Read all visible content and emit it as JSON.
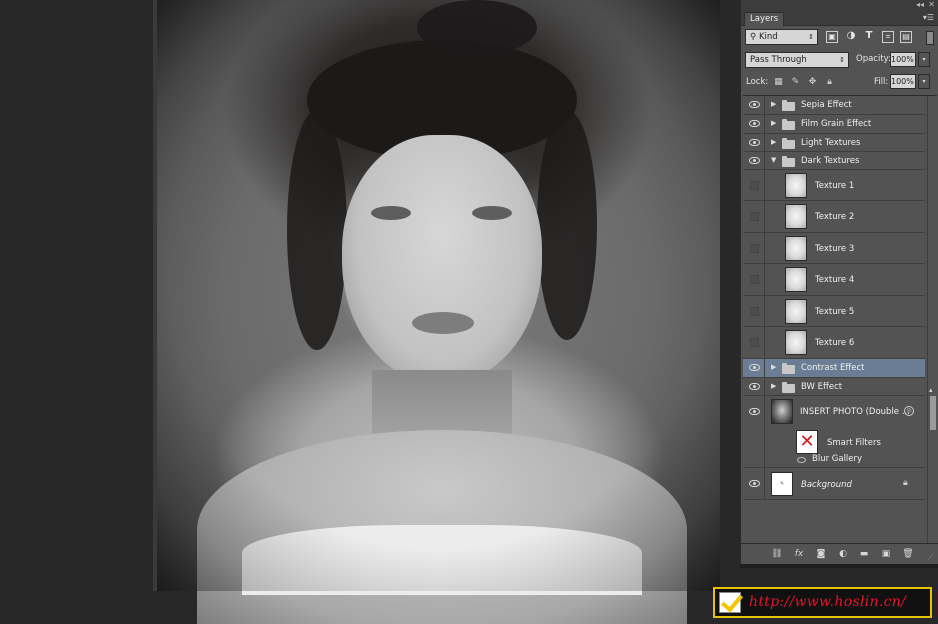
{
  "canvas": {
    "description_icon": "portrait-photo"
  },
  "panel": {
    "tab_label": "Layers",
    "kind_filter": {
      "value": "Kind"
    },
    "blend_mode": {
      "value": "Pass Through"
    },
    "opacity": {
      "label": "Opacity:",
      "value": "100%"
    },
    "lock": {
      "label": "Lock:"
    },
    "fill": {
      "label": "Fill:",
      "value": "100%"
    },
    "layers": [
      {
        "name": "Sepia Effect",
        "type": "group",
        "visible": true,
        "expanded": false
      },
      {
        "name": "Film Grain Effect",
        "type": "group",
        "visible": true,
        "expanded": false
      },
      {
        "name": "Light Textures",
        "type": "group",
        "visible": true,
        "expanded": false
      },
      {
        "name": "Dark Textures",
        "type": "group",
        "visible": true,
        "expanded": true
      },
      {
        "name": "Texture 1",
        "type": "texture",
        "visible": false
      },
      {
        "name": "Texture 2",
        "type": "texture",
        "visible": false
      },
      {
        "name": "Texture 3",
        "type": "texture",
        "visible": false
      },
      {
        "name": "Texture 4",
        "type": "texture",
        "visible": false
      },
      {
        "name": "Texture 5",
        "type": "texture",
        "visible": false
      },
      {
        "name": "Texture 6",
        "type": "texture",
        "visible": false
      },
      {
        "name": "Contrast Effect",
        "type": "group",
        "visible": true,
        "expanded": false,
        "selected": true
      },
      {
        "name": "BW Effect",
        "type": "group",
        "visible": true,
        "expanded": false
      },
      {
        "name": "INSERT PHOTO (Double ...",
        "type": "smart-object",
        "visible": true
      },
      {
        "name": "Smart Filters",
        "type": "smart-filters"
      },
      {
        "name": "Blur Gallery",
        "type": "filter"
      },
      {
        "name": "Background",
        "type": "background",
        "visible": true,
        "locked": true
      }
    ]
  },
  "watermark": {
    "url": "http://www.hoslin.cn/"
  },
  "colors": {
    "panel_bg": "#535353",
    "selected_row": "#6b7d95",
    "watermark_text": "#e8112d",
    "watermark_border": "#e6c300"
  }
}
